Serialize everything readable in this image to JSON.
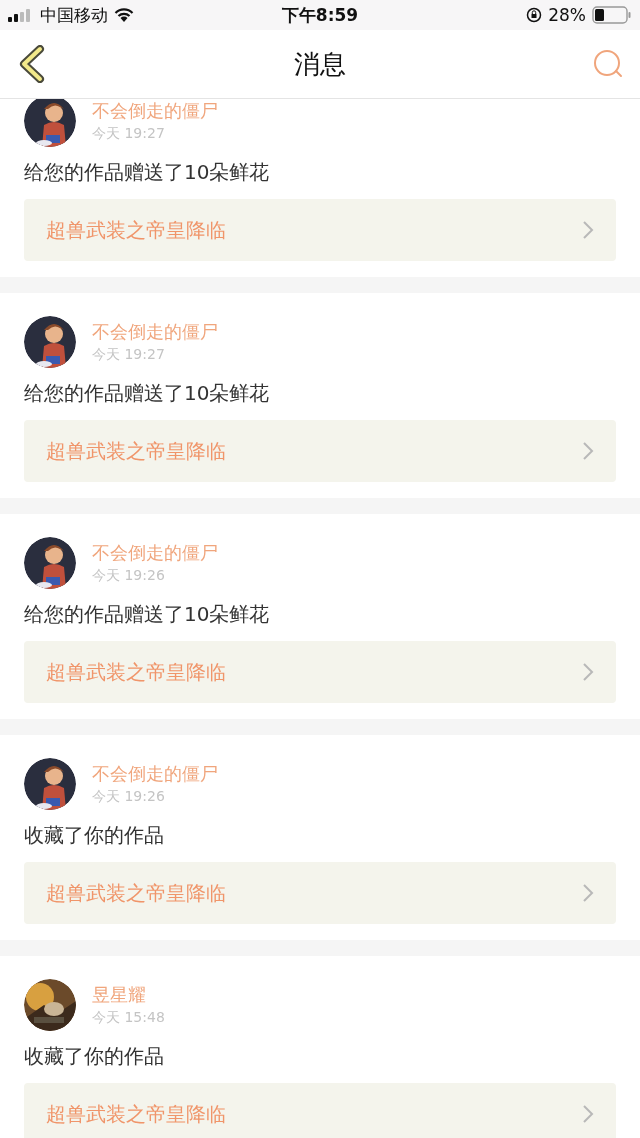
{
  "status_bar": {
    "carrier": "中国移动",
    "time": "下午8:59",
    "battery": "28%"
  },
  "nav": {
    "title": "消息"
  },
  "messages": [
    {
      "user": "不会倒走的僵尸",
      "time": "今天 19:27",
      "text": "给您的作品赠送了10朵鲜花",
      "work": "超兽武装之帝皇降临"
    },
    {
      "user": "不会倒走的僵尸",
      "time": "今天 19:27",
      "text": "给您的作品赠送了10朵鲜花",
      "work": "超兽武装之帝皇降临"
    },
    {
      "user": "不会倒走的僵尸",
      "time": "今天 19:26",
      "text": "给您的作品赠送了10朵鲜花",
      "work": "超兽武装之帝皇降临"
    },
    {
      "user": "不会倒走的僵尸",
      "time": "今天 19:26",
      "text": "收藏了你的作品",
      "work": "超兽武装之帝皇降临"
    },
    {
      "user": "昱星耀",
      "time": "今天 15:48",
      "text": "收藏了你的作品",
      "work": "超兽武装之帝皇降临"
    }
  ]
}
